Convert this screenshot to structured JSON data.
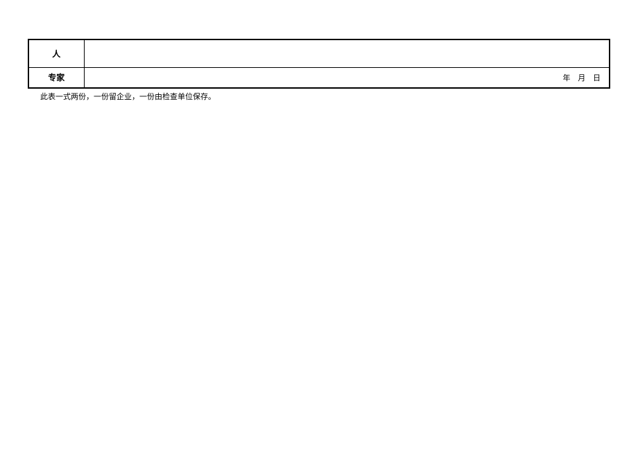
{
  "table": {
    "rows": [
      {
        "label": "人",
        "value": ""
      },
      {
        "label": "专家",
        "value": "",
        "date_text": "年  月  日"
      }
    ]
  },
  "footer_note": "此表一式两份，一份留企业，一份由检查单位保存。"
}
